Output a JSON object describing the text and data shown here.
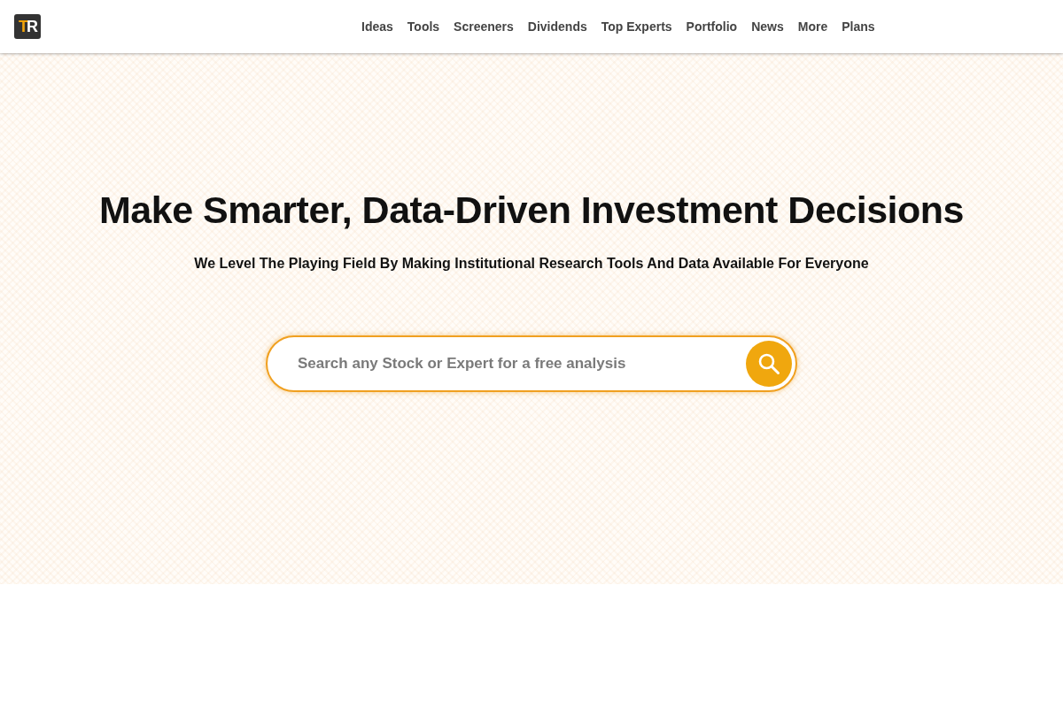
{
  "logo": {
    "letters": [
      "T",
      "R"
    ]
  },
  "nav": [
    {
      "label": "Ideas"
    },
    {
      "label": "Tools"
    },
    {
      "label": "Screeners"
    },
    {
      "label": "Dividends"
    },
    {
      "label": "Top Experts"
    },
    {
      "label": "Portfolio"
    },
    {
      "label": "News"
    },
    {
      "label": "More"
    },
    {
      "label": "Plans"
    }
  ],
  "hero": {
    "title": "Make Smarter, Data-Driven Investment Decisions",
    "subtitle": "We Level The Playing Field By Making Institutional Research Tools And Data Available For Everyone",
    "search": {
      "placeholder": "Search any Stock or Expert for a free analysis"
    }
  }
}
